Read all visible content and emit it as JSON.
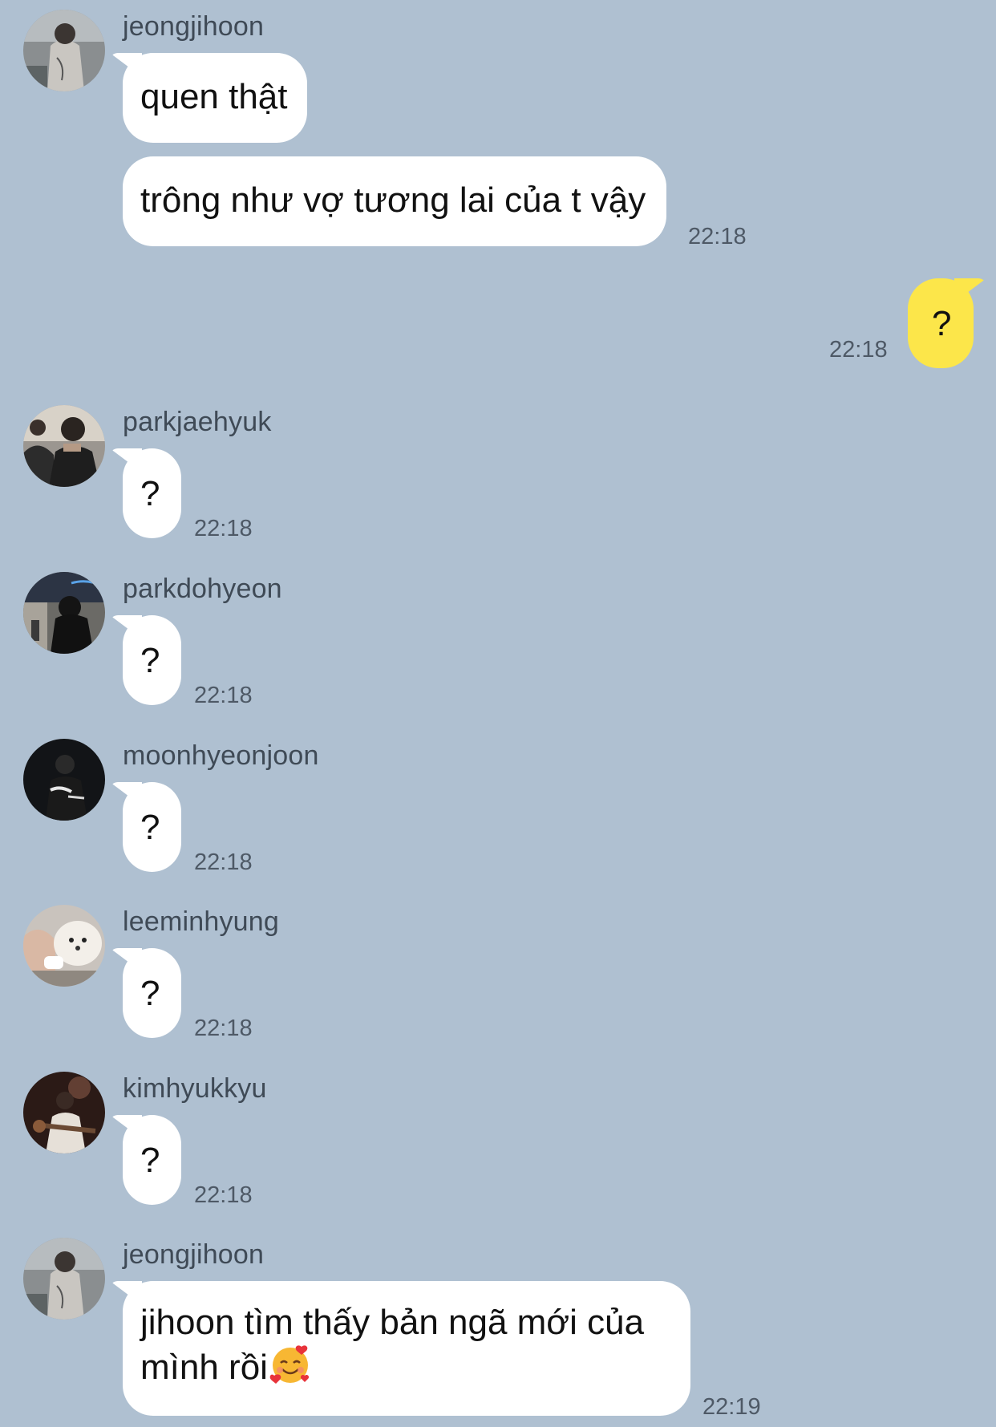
{
  "messages": [
    {
      "sender": "jeongjihoon",
      "avatar": "avatar-jeongjihoon",
      "text": "quen thật"
    },
    {
      "sender": "jeongjihoon",
      "text": "trông như vợ tương lai của t vậy",
      "time": "22:18"
    },
    {
      "sender": "me",
      "text": "?",
      "time": "22:18"
    },
    {
      "sender": "parkjaehyuk",
      "avatar": "avatar-parkjaehyuk",
      "text": "?",
      "time": "22:18"
    },
    {
      "sender": "parkdohyeon",
      "avatar": "avatar-parkdohyeon",
      "text": "?",
      "time": "22:18"
    },
    {
      "sender": "moonhyeonjoon",
      "avatar": "avatar-moonhyeonjoon",
      "text": "?",
      "time": "22:18"
    },
    {
      "sender": "leeminhyung",
      "avatar": "avatar-leeminhyung",
      "text": "?",
      "time": "22:18"
    },
    {
      "sender": "kimhyukkyu",
      "avatar": "avatar-kimhyukkyu",
      "text": "?",
      "time": "22:18"
    },
    {
      "sender": "jeongjihoon",
      "avatar": "avatar-jeongjihoon",
      "text_line1": "jihoon tìm thấy bản ngã mới của",
      "text_line2": "mình rồi",
      "emoji": "smiling-face-with-hearts-icon",
      "time": "22:19"
    }
  ],
  "colors": {
    "background": "#afc0d1",
    "incoming_bubble": "#ffffff",
    "outgoing_bubble": "#fce64a",
    "sender_name": "#3f4a56",
    "timestamp": "#4e5966"
  }
}
